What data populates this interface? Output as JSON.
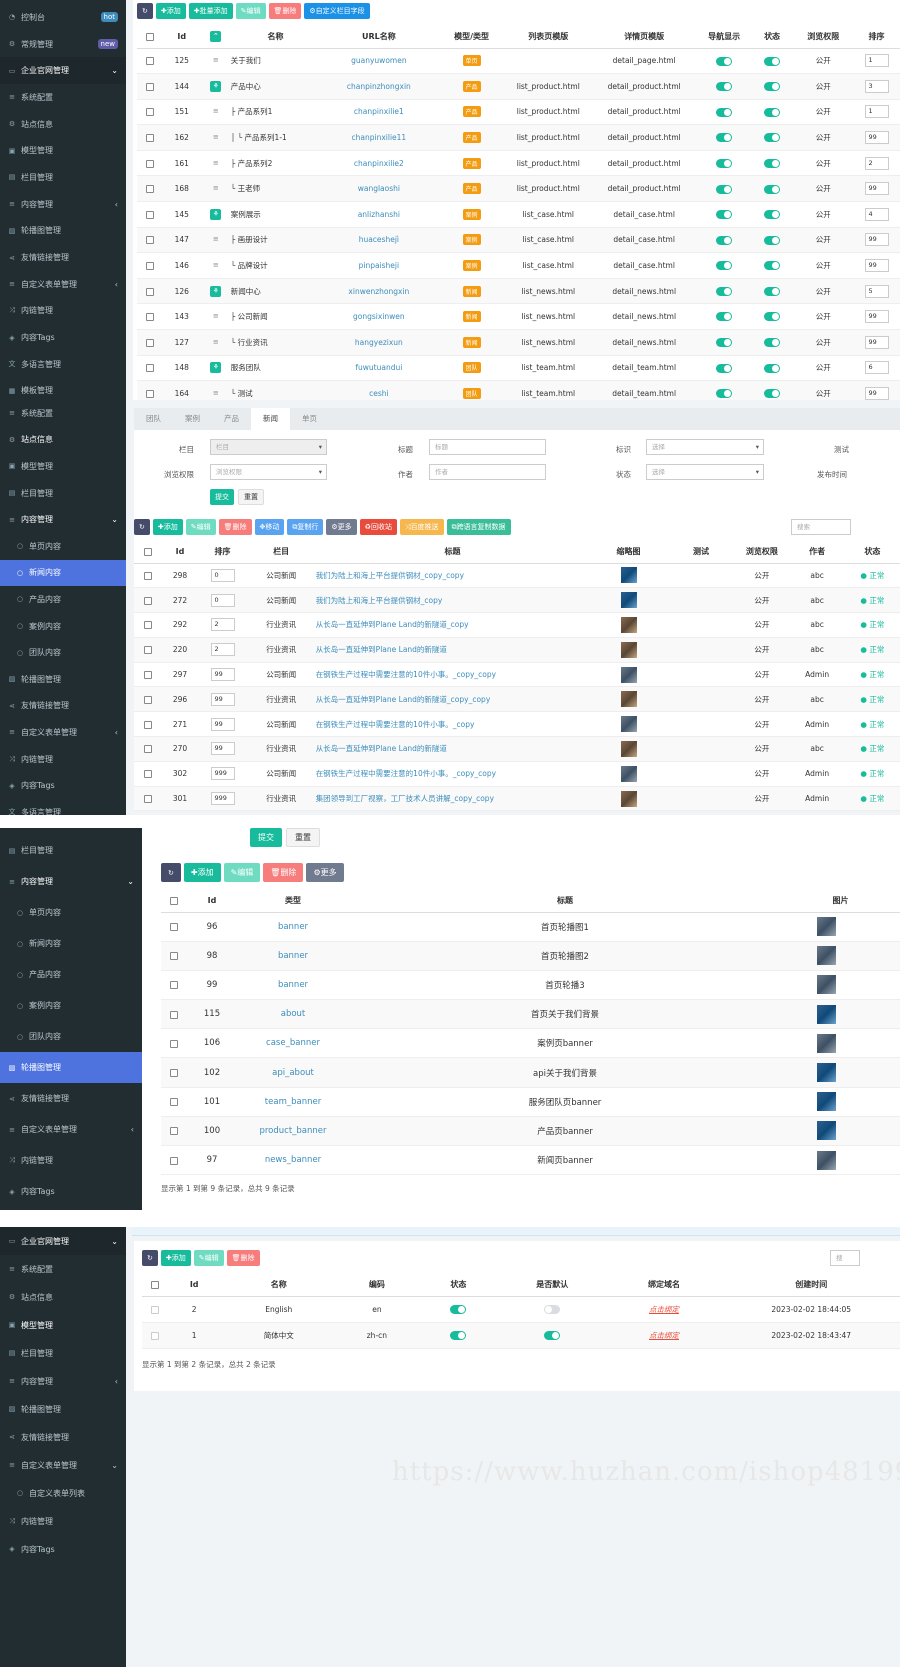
{
  "colors": {
    "sidebar": "#222d32",
    "active": "#4e73df",
    "success": "#18bc9c",
    "tag": "#f39c12"
  },
  "panel1": {
    "sidebar": [
      {
        "icon": "dashboard-icon",
        "label": "控制台",
        "badge": "hot"
      },
      {
        "icon": "gear-icon",
        "label": "常规管理",
        "badge": "new"
      },
      {
        "icon": "desktop-icon",
        "label": "企业官网管理",
        "arrow": "⌄"
      },
      {
        "icon": "list-icon",
        "label": "系统配置"
      },
      {
        "icon": "gear-icon",
        "label": "站点信息"
      },
      {
        "icon": "cube-icon",
        "label": "模型管理"
      },
      {
        "icon": "file-icon",
        "label": "栏目管理"
      },
      {
        "icon": "list-icon",
        "label": "内容管理",
        "arrow": "‹"
      },
      {
        "icon": "image-icon",
        "label": "轮播图管理"
      },
      {
        "icon": "share-icon",
        "label": "友情链接管理"
      },
      {
        "icon": "list-icon",
        "label": "自定义表单管理",
        "arrow": "‹"
      },
      {
        "icon": "shuffle-icon",
        "label": "内链管理"
      },
      {
        "icon": "tags-icon",
        "label": "内容Tags"
      },
      {
        "icon": "language-icon",
        "label": "多语言管理"
      },
      {
        "icon": "ticket-icon",
        "label": "模板管理"
      }
    ],
    "toolbar": [
      "添加",
      "批量添加",
      "编辑",
      "删除",
      "自定义栏目字段"
    ],
    "headers": [
      "",
      "Id",
      "",
      "名称",
      "URL名称",
      "模型/类型",
      "列表页模版",
      "详情页模版",
      "导航显示",
      "状态",
      "浏览权限",
      "排序"
    ],
    "rows": [
      {
        "id": "125",
        "icon": "list",
        "name": "关于我们",
        "url": "guanyuwomen",
        "tag": "单页",
        "list": "",
        "detail": "detail_page.html",
        "perm": "公开",
        "sort": "1"
      },
      {
        "id": "144",
        "icon": "tree",
        "name": "产品中心",
        "url": "chanpinzhongxin",
        "tag": "产品",
        "list": "list_product.html",
        "detail": "detail_product.html",
        "perm": "公开",
        "sort": "3"
      },
      {
        "id": "151",
        "icon": "list",
        "name": "├ 产品系列1",
        "url": "chanpinxilie1",
        "tag": "产品",
        "list": "list_product.html",
        "detail": "detail_product.html",
        "perm": "公开",
        "sort": "1"
      },
      {
        "id": "162",
        "icon": "list",
        "name": "│ └ 产品系列1-1",
        "url": "chanpinxilie11",
        "tag": "产品",
        "list": "list_product.html",
        "detail": "detail_product.html",
        "perm": "公开",
        "sort": "99"
      },
      {
        "id": "161",
        "icon": "list",
        "name": "├ 产品系列2",
        "url": "chanpinxilie2",
        "tag": "产品",
        "list": "list_product.html",
        "detail": "detail_product.html",
        "perm": "公开",
        "sort": "2"
      },
      {
        "id": "168",
        "icon": "list",
        "name": "└ 王老师",
        "url": "wanglaoshi",
        "tag": "产品",
        "list": "list_product.html",
        "detail": "detail_product.html",
        "perm": "公开",
        "sort": "99"
      },
      {
        "id": "145",
        "icon": "tree",
        "name": "案例展示",
        "url": "anlizhanshi",
        "tag": "案例",
        "list": "list_case.html",
        "detail": "detail_case.html",
        "perm": "公开",
        "sort": "4"
      },
      {
        "id": "147",
        "icon": "list",
        "name": "├ 画册设计",
        "url": "huaceshejì",
        "tag": "案例",
        "list": "list_case.html",
        "detail": "detail_case.html",
        "perm": "公开",
        "sort": "99"
      },
      {
        "id": "146",
        "icon": "list",
        "name": "└ 品牌设计",
        "url": "pinpaisheji",
        "tag": "案例",
        "list": "list_case.html",
        "detail": "detail_case.html",
        "perm": "公开",
        "sort": "99"
      },
      {
        "id": "126",
        "icon": "tree",
        "name": "新闻中心",
        "url": "xinwenzhongxin",
        "tag": "新闻",
        "list": "list_news.html",
        "detail": "detail_news.html",
        "perm": "公开",
        "sort": "5"
      },
      {
        "id": "143",
        "icon": "list",
        "name": "├ 公司新闻",
        "url": "gongsixinwen",
        "tag": "新闻",
        "list": "list_news.html",
        "detail": "detail_news.html",
        "perm": "公开",
        "sort": "99"
      },
      {
        "id": "127",
        "icon": "list",
        "name": "└ 行业资讯",
        "url": "hangyezixun",
        "tag": "新闻",
        "list": "list_news.html",
        "detail": "detail_news.html",
        "perm": "公开",
        "sort": "99"
      },
      {
        "id": "148",
        "icon": "tree",
        "name": "服务团队",
        "url": "fuwutuandui",
        "tag": "团队",
        "list": "list_team.html",
        "detail": "detail_team.html",
        "perm": "公开",
        "sort": "6"
      },
      {
        "id": "164",
        "icon": "list",
        "name": "└ 测试",
        "url": "ceshi",
        "tag": "团队",
        "list": "list_team.html",
        "detail": "detail_team.html",
        "perm": "公开",
        "sort": "99"
      }
    ]
  },
  "panel2": {
    "sidebar": [
      {
        "icon": "list-icon",
        "label": "系统配置"
      },
      {
        "icon": "gear-icon",
        "label": "站点信息",
        "open": true
      },
      {
        "icon": "cube-icon",
        "label": "模型管理"
      },
      {
        "icon": "file-icon",
        "label": "栏目管理"
      },
      {
        "icon": "list-icon",
        "label": "内容管理",
        "arrow": "⌄",
        "open": true
      },
      {
        "icon": "circle-icon",
        "label": "单页内容",
        "sub": true
      },
      {
        "icon": "circle-icon",
        "label": "新闻内容",
        "sub": true,
        "active": true
      },
      {
        "icon": "circle-icon",
        "label": "产品内容",
        "sub": true
      },
      {
        "icon": "circle-icon",
        "label": "案例内容",
        "sub": true
      },
      {
        "icon": "circle-icon",
        "label": "团队内容",
        "sub": true
      },
      {
        "icon": "image-icon",
        "label": "轮播图管理"
      },
      {
        "icon": "share-icon",
        "label": "友情链接管理"
      },
      {
        "icon": "list-icon",
        "label": "自定义表单管理",
        "arrow": "‹"
      },
      {
        "icon": "shuffle-icon",
        "label": "内链管理"
      },
      {
        "icon": "tags-icon",
        "label": "内容Tags"
      },
      {
        "icon": "language-icon",
        "label": "多语言管理"
      }
    ],
    "tabs": [
      "团队",
      "案例",
      "产品",
      "新闻",
      "单页"
    ],
    "form": {
      "column_label": "栏目",
      "column_value": "栏目",
      "title_label": "标题",
      "title_ph": "标题",
      "flag_label": "标识",
      "flag_ph": "选择",
      "test_label": "测试",
      "perm_label": "浏览权限",
      "perm_ph": "浏览权限",
      "author_label": "作者",
      "author_ph": "作者",
      "status_label": "状态",
      "status_ph": "选择",
      "pubtime_label": "发布时间",
      "submit": "提交",
      "reset": "重置"
    },
    "toolbar": [
      "添加",
      "编辑",
      "删除",
      "移动",
      "复制行",
      "更多",
      "回收站",
      "百度推送",
      "跨语言复制数据"
    ],
    "search_ph": "搜索",
    "headers": [
      "",
      "Id",
      "排序",
      "栏目",
      "标题",
      "缩略图",
      "测试",
      "浏览权限",
      "作者",
      "状态"
    ],
    "rows": [
      {
        "id": "298",
        "sort": "0",
        "col": "公司新闻",
        "title": "我们为陆上和海上平台提供钢材_copy_copy",
        "thumb": "b",
        "perm": "公开",
        "author": "abc",
        "status": "正常"
      },
      {
        "id": "272",
        "sort": "0",
        "col": "公司新闻",
        "title": "我们为陆上和海上平台提供钢材_copy",
        "thumb": "b",
        "perm": "公开",
        "author": "abc",
        "status": "正常"
      },
      {
        "id": "292",
        "sort": "2",
        "col": "行业资讯",
        "title": "从长岛一直延伸到Plane Land的新隧道_copy",
        "thumb": "w",
        "perm": "公开",
        "author": "abc",
        "status": "正常"
      },
      {
        "id": "220",
        "sort": "2",
        "col": "行业资讯",
        "title": "从长岛一直延伸到Plane Land的新隧道",
        "thumb": "w",
        "perm": "公开",
        "author": "abc",
        "status": "正常"
      },
      {
        "id": "297",
        "sort": "99",
        "col": "公司新闻",
        "title": "在钢铁生产过程中需要注意的10件小事。_copy_copy",
        "thumb": "g",
        "perm": "公开",
        "author": "Admin",
        "status": "正常"
      },
      {
        "id": "296",
        "sort": "99",
        "col": "行业资讯",
        "title": "从长岛一直延伸到Plane Land的新隧道_copy_copy",
        "thumb": "w",
        "perm": "公开",
        "author": "abc",
        "status": "正常"
      },
      {
        "id": "271",
        "sort": "99",
        "col": "公司新闻",
        "title": "在钢铁生产过程中需要注意的10件小事。_copy",
        "thumb": "g",
        "perm": "公开",
        "author": "Admin",
        "status": "正常"
      },
      {
        "id": "270",
        "sort": "99",
        "col": "行业资讯",
        "title": "从长岛一直延伸到Plane Land的新隧道",
        "thumb": "w",
        "perm": "公开",
        "author": "abc",
        "status": "正常"
      },
      {
        "id": "302",
        "sort": "999",
        "col": "公司新闻",
        "title": "在钢铁生产过程中需要注意的10件小事。_copy_copy",
        "thumb": "g",
        "perm": "公开",
        "author": "Admin",
        "status": "正常"
      },
      {
        "id": "301",
        "sort": "999",
        "col": "行业资讯",
        "title": "集团领导到工厂视察，工厂技术人员讲解_copy_copy",
        "thumb": "w",
        "perm": "公开",
        "author": "Admin",
        "status": "正常"
      }
    ]
  },
  "panel3": {
    "sidebar": [
      {
        "icon": "file-icon",
        "label": "栏目管理"
      },
      {
        "icon": "list-icon",
        "label": "内容管理",
        "arrow": "⌄",
        "open": true
      },
      {
        "icon": "circle-icon",
        "label": "单页内容",
        "sub": true
      },
      {
        "icon": "circle-icon",
        "label": "新闻内容",
        "sub": true
      },
      {
        "icon": "circle-icon",
        "label": "产品内容",
        "sub": true
      },
      {
        "icon": "circle-icon",
        "label": "案例内容",
        "sub": true
      },
      {
        "icon": "circle-icon",
        "label": "团队内容",
        "sub": true
      },
      {
        "icon": "image-icon",
        "label": "轮播图管理",
        "active": true
      },
      {
        "icon": "share-icon",
        "label": "友情链接管理"
      },
      {
        "icon": "list-icon",
        "label": "自定义表单管理",
        "arrow": "‹"
      },
      {
        "icon": "shuffle-icon",
        "label": "内链管理"
      },
      {
        "icon": "tags-icon",
        "label": "内容Tags"
      }
    ],
    "submit": "提交",
    "reset": "重置",
    "toolbar": [
      "添加",
      "编辑",
      "删除",
      "更多"
    ],
    "headers": [
      "",
      "Id",
      "类型",
      "标题",
      "图片"
    ],
    "rows": [
      {
        "id": "96",
        "type": "banner",
        "title": "首页轮播图1",
        "img": "g"
      },
      {
        "id": "98",
        "type": "banner",
        "title": "首页轮播图2",
        "img": "g"
      },
      {
        "id": "99",
        "type": "banner",
        "title": "首页轮播3",
        "img": "g"
      },
      {
        "id": "115",
        "type": "about",
        "title": "首页关于我们背景",
        "img": "b"
      },
      {
        "id": "106",
        "type": "case_banner",
        "title": "案例页banner",
        "img": "g"
      },
      {
        "id": "102",
        "type": "api_about",
        "title": "api关于我们背景",
        "img": "b"
      },
      {
        "id": "101",
        "type": "team_banner",
        "title": "服务团队页banner",
        "img": "b"
      },
      {
        "id": "100",
        "type": "product_banner",
        "title": "产品页banner",
        "img": "b"
      },
      {
        "id": "97",
        "type": "news_banner",
        "title": "新闻页banner",
        "img": "g"
      }
    ],
    "footer": "显示第 1 到第 9 条记录，总共 9 条记录"
  },
  "panel4": {
    "sidebar": [
      {
        "icon": "desktop-icon",
        "label": "企业官网管理",
        "arrow": "⌄",
        "open": true
      },
      {
        "icon": "list-icon",
        "label": "系统配置"
      },
      {
        "icon": "gear-icon",
        "label": "站点信息"
      },
      {
        "icon": "cube-icon",
        "label": "模型管理",
        "open": true
      },
      {
        "icon": "file-icon",
        "label": "栏目管理"
      },
      {
        "icon": "list-icon",
        "label": "内容管理",
        "arrow": "‹"
      },
      {
        "icon": "image-icon",
        "label": "轮播图管理"
      },
      {
        "icon": "share-icon",
        "label": "友情链接管理"
      },
      {
        "icon": "list-icon",
        "label": "自定义表单管理",
        "arrow": "⌄"
      },
      {
        "icon": "circle-icon",
        "label": "自定义表单列表",
        "sub": true
      },
      {
        "icon": "shuffle-icon",
        "label": "内链管理"
      },
      {
        "icon": "tags-icon",
        "label": "内容Tags"
      }
    ],
    "toolbar": [
      "添加",
      "编辑",
      "删除"
    ],
    "search_ph": "搜",
    "headers": [
      "",
      "Id",
      "名称",
      "编码",
      "状态",
      "是否默认",
      "绑定域名",
      "创建时间"
    ],
    "rows": [
      {
        "id": "2",
        "name": "English",
        "code": "en",
        "status": true,
        "default": false,
        "bind": "点击绑定",
        "time": "2023-02-02 18:44:05"
      },
      {
        "id": "1",
        "name": "简体中文",
        "code": "zh-cn",
        "status": true,
        "default": true,
        "bind": "点击绑定",
        "time": "2023-02-02 18:43:47"
      }
    ],
    "footer": "显示第 1 到第 2 条记录，总共 2 条记录"
  },
  "watermark": "https://www.huzhan.com/ishop48199"
}
